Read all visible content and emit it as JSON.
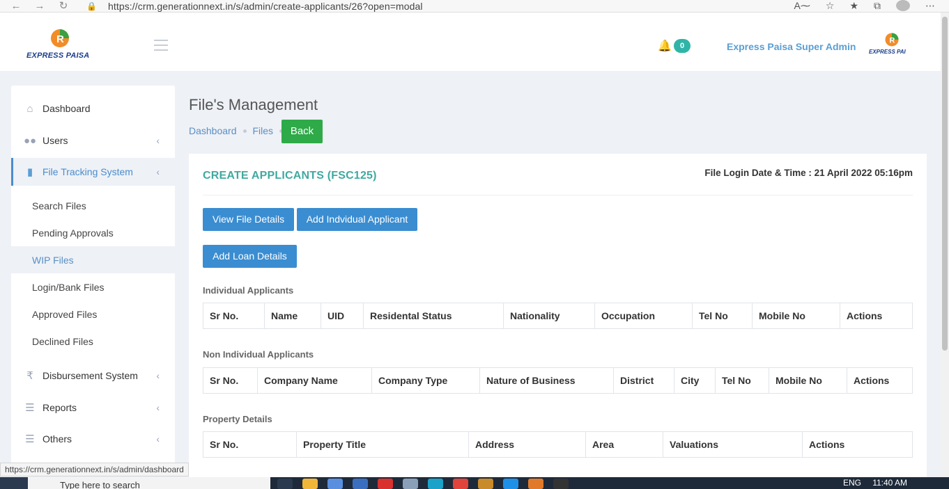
{
  "browser": {
    "url": "https://crm.generationnext.in/s/admin/create-applicants/26?open=modal",
    "status_url": "https://crm.generationnext.in/s/admin/dashboard"
  },
  "header": {
    "logo_text": "EXPRESS PAISA",
    "notification_count": "0",
    "admin_name": "Express Paisa Super Admin",
    "small_logo_text": "EXPRESS PAI"
  },
  "sidebar": {
    "items": [
      {
        "label": "Dashboard",
        "icon": "home-icon"
      },
      {
        "label": "Users",
        "icon": "users-icon"
      },
      {
        "label": "File Tracking System",
        "icon": "file-icon"
      },
      {
        "label": "Disbursement System",
        "icon": "rupee-icon"
      },
      {
        "label": "Reports",
        "icon": "list-icon"
      },
      {
        "label": "Others",
        "icon": "list-icon"
      }
    ],
    "sub_items": [
      "Search Files",
      "Pending Approvals",
      "WIP Files",
      "Login/Bank Files",
      "Approved Files",
      "Declined Files"
    ]
  },
  "page": {
    "title": "File's Management",
    "breadcrumb": [
      "Dashboard",
      "Files"
    ],
    "back_label": "Back"
  },
  "card": {
    "title": "CREATE APPLICANTS (FSC125)",
    "login_info": "File Login Date & Time : 21 April 2022 05:16pm",
    "buttons": {
      "view_file_details": "View File Details",
      "add_individual_applicant": "Add Indvidual Applicant",
      "add_loan_details": "Add Loan Details"
    },
    "individual": {
      "label": "Individual Applicants",
      "columns": [
        "Sr No.",
        "Name",
        "UID",
        "Residental Status",
        "Nationality",
        "Occupation",
        "Tel No",
        "Mobile No",
        "Actions"
      ]
    },
    "non_individual": {
      "label": "Non Individual Applicants",
      "columns": [
        "Sr No.",
        "Company Name",
        "Company Type",
        "Nature of Business",
        "District",
        "City",
        "Tel No",
        "Mobile No",
        "Actions"
      ]
    },
    "property": {
      "label": "Property Details",
      "columns": [
        "Sr No.",
        "Property Title",
        "Address",
        "Area",
        "Valuations",
        "Actions"
      ]
    }
  },
  "taskbar": {
    "search_placeholder": "Type here to search",
    "lang": "ENG",
    "time": "11:40 AM"
  },
  "colors": {
    "accent_teal": "#40a9a0",
    "button_blue": "#3a8dd1",
    "back_green": "#2eaa48",
    "link_blue": "#5a8fc5"
  }
}
